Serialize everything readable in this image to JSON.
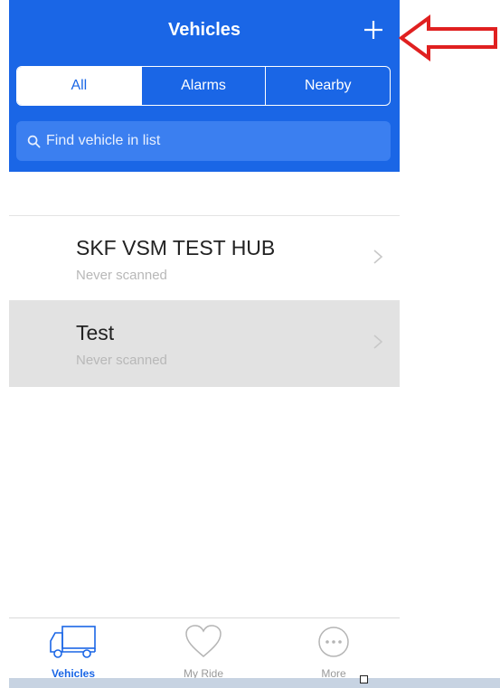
{
  "header": {
    "title": "Vehicles",
    "add_icon": "plus-icon"
  },
  "segments": [
    {
      "label": "All",
      "selected": true
    },
    {
      "label": "Alarms",
      "selected": false
    },
    {
      "label": "Nearby",
      "selected": false
    }
  ],
  "search": {
    "placeholder": "Find vehicle in list",
    "icon": "search-icon"
  },
  "vehicles": [
    {
      "name": "SKF VSM TEST HUB",
      "status": "Never scanned"
    },
    {
      "name": "Test",
      "status": "Never scanned"
    }
  ],
  "tabbar": {
    "items": [
      {
        "label": "Vehicles",
        "icon": "truck-icon",
        "active": true
      },
      {
        "label": "My Ride",
        "icon": "heart-icon",
        "active": false
      },
      {
        "label": "More",
        "icon": "more-icon",
        "active": false
      }
    ]
  },
  "colors": {
    "header_blue": "#1a66e6",
    "annotation_red": "#e02020"
  }
}
